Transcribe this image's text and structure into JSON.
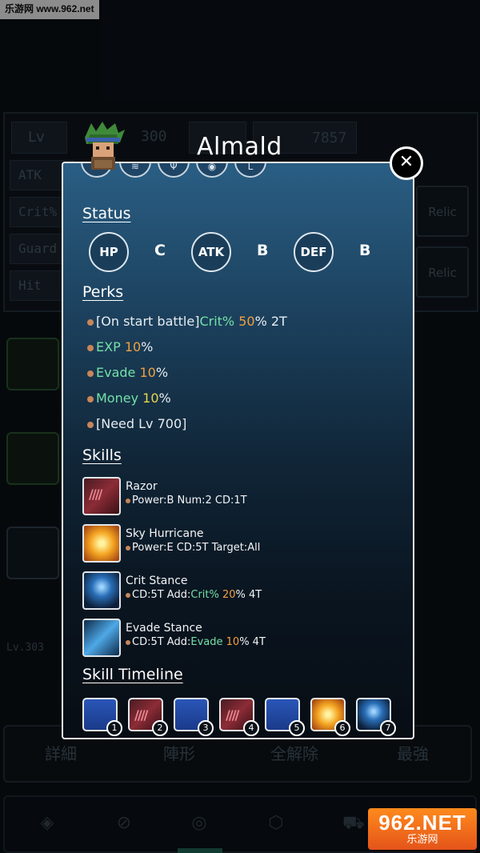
{
  "watermark": {
    "top": "乐游网 www.962.net",
    "bottom_big": "962.NET",
    "bottom_small": "乐游网"
  },
  "background": {
    "lv_label": "Lv",
    "lv_value": "300",
    "top_value": "7857",
    "stat_labels": [
      "ATK",
      "Crit%",
      "Guard",
      "Hit"
    ],
    "relic_labels": [
      "Relic",
      "Relic"
    ],
    "party_level": "Lv.303",
    "tabs": [
      "詳細",
      "陣形",
      "全解除",
      "最強"
    ],
    "nav_icons": [
      "diamond-icon",
      "compass-icon",
      "character-icon",
      "cube-icon",
      "cart-icon"
    ]
  },
  "character": {
    "name": "Almald"
  },
  "modal": {
    "top_icons": [
      "sword-icon",
      "wing-icon",
      "trident-icon",
      "eye-icon",
      "boot-icon"
    ],
    "status": {
      "heading": "Status",
      "items": [
        {
          "label": "HP",
          "grade": "C"
        },
        {
          "label": "ATK",
          "grade": "B"
        },
        {
          "label": "DEF",
          "grade": "B"
        }
      ]
    },
    "perks": {
      "heading": "Perks",
      "items": [
        {
          "prefix": "[On start battle]",
          "key": "Crit%",
          "val": "50",
          "suffix": "% 2T"
        },
        {
          "prefix": "",
          "key": "EXP",
          "val": "10",
          "suffix": "%"
        },
        {
          "prefix": "",
          "key": "Evade",
          "val": "10",
          "suffix": "%"
        },
        {
          "prefix": "",
          "key": "Money",
          "val": "10",
          "suffix": "%"
        },
        {
          "prefix": "[Need Lv 700]",
          "key": "",
          "val": "",
          "suffix": ""
        }
      ]
    },
    "skills": {
      "heading": "Skills",
      "items": [
        {
          "name": "Razor",
          "desc_a": "Power:B Num:2 CD:1T",
          "key": "",
          "val": "",
          "tail": ""
        },
        {
          "name": "Sky Hurricane",
          "desc_a": "Power:E CD:5T Target:All",
          "key": "",
          "val": "",
          "tail": ""
        },
        {
          "name": "Crit Stance",
          "desc_a": "CD:5T Add:",
          "key": "Crit%",
          "val": "20",
          "tail": "%  4T"
        },
        {
          "name": "Evade Stance",
          "desc_a": "CD:5T Add:",
          "key": "Evade",
          "val": "10",
          "tail": "%  4T"
        }
      ]
    },
    "timeline": {
      "heading": "Skill Timeline",
      "slots": [
        "1",
        "2",
        "3",
        "4",
        "5",
        "6",
        "7"
      ]
    }
  }
}
